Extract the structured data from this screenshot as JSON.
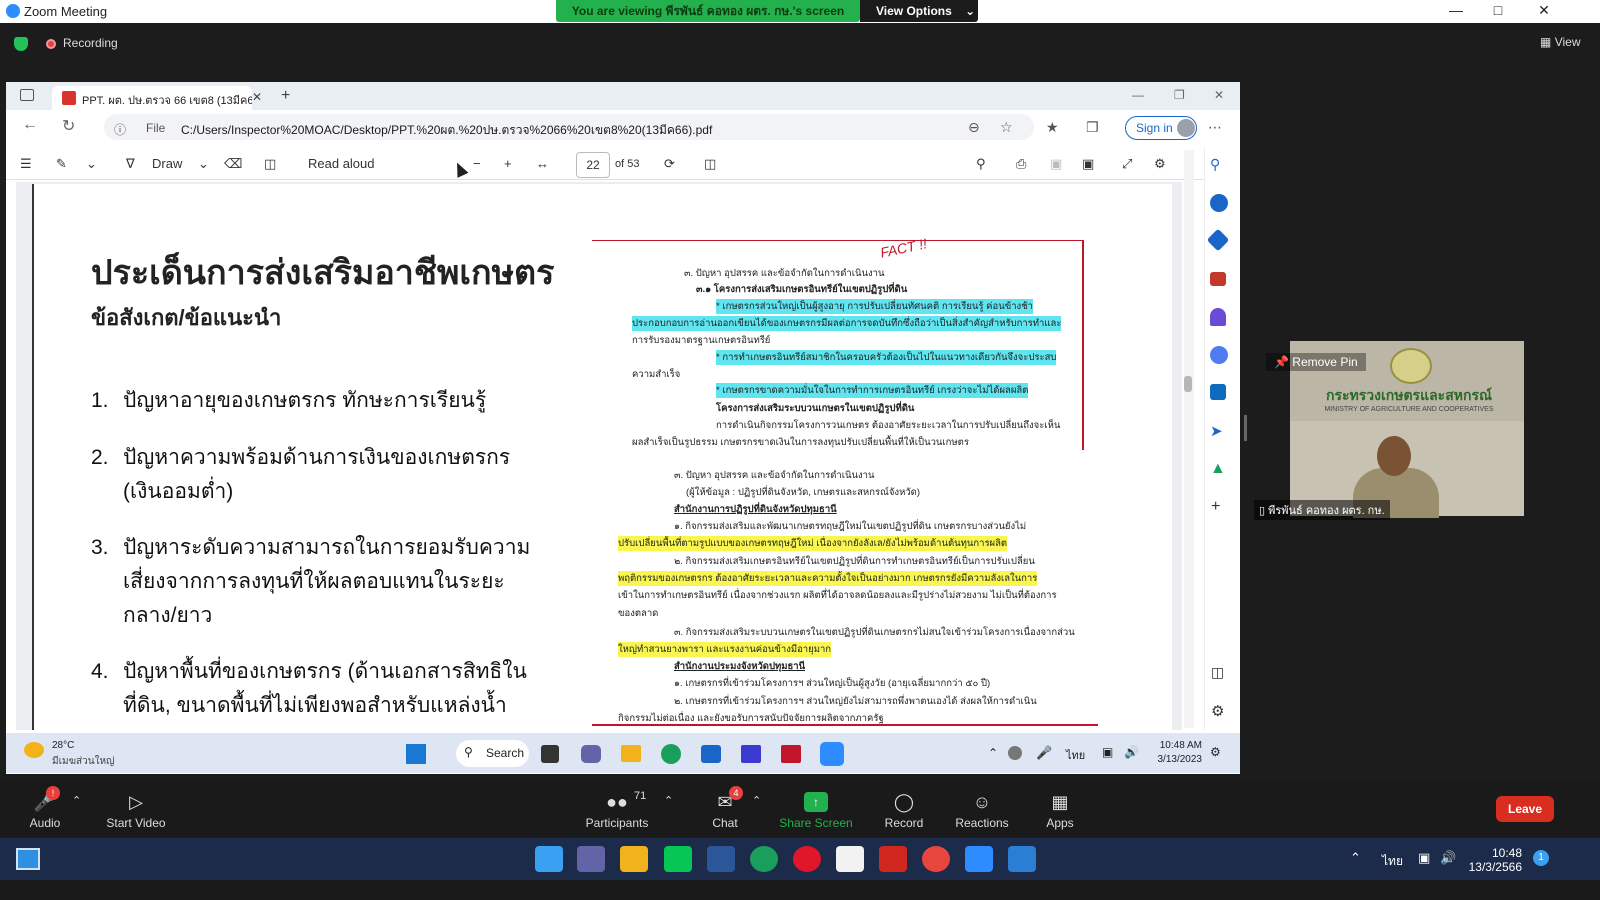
{
  "zoom": {
    "window_title": "Zoom Meeting",
    "banner_text": "You are viewing พีรพันธ์ คอทอง ผตร. กษ.'s screen",
    "view_options_label": "View Options",
    "recording_label": "Recording",
    "view_label": "View",
    "controls": {
      "audio": "Audio",
      "start_video": "Start Video",
      "participants": "Participants",
      "participants_count": "71",
      "chat": "Chat",
      "chat_badge": "4",
      "share_screen": "Share Screen",
      "record": "Record",
      "reactions": "Reactions",
      "apps": "Apps",
      "leave": "Leave"
    },
    "video": {
      "remove_pin": "Remove Pin",
      "name": "พีรพันธ์ คอทอง ผตร. กษ.",
      "ministry_th": "กระทรวงเกษตรและสหกรณ์",
      "ministry_en": "MINISTRY OF AGRICULTURE AND COOPERATIVES"
    }
  },
  "browser": {
    "tab_title": "PPT. ผต. ปษ.ตรวจ 66 เขต8 (13มีค6",
    "url_prefix": "File",
    "url": "C:/Users/Inspector%20MOAC/Desktop/PPT.%20ผต.%20ปษ.ตรวจ%2066%20เขต8%20(13มีค66).pdf",
    "sign_in": "Sign in",
    "pdf_toolbar": {
      "draw": "Draw",
      "read_aloud": "Read aloud",
      "page": "22",
      "page_total": "of 53"
    }
  },
  "slide": {
    "title": "ประเด็นการส่งเสริมอาชีพเกษตร",
    "subtitle": "ข้อสังเกต/ข้อแนะนำ",
    "items": [
      {
        "num": "1.",
        "text": "ปัญหาอายุของเกษตรกร ทักษะการเรียนรู้"
      },
      {
        "num": "2.",
        "text": "ปัญหาความพร้อมด้านการเงินของเกษตรกร (เงินออมต่ำ)"
      },
      {
        "num": "3.",
        "text": "ปัญหาระดับความสามารถในการยอมรับความเสี่ยงจากการลงทุนที่ให้ผลตอบแทนในระยะกลาง/ยาว"
      },
      {
        "num": "4.",
        "text": "ปัญหาพื้นที่ของเกษตรกร (ด้านเอกสารสิทธิในที่ดิน, ขนาดพื้นที่ไม่เพียงพอสำหรับแหล่งน้ำ"
      }
    ],
    "handwriting": "FACT !!",
    "scan_lines": [
      "๓. ปัญหา อุปสรรค และข้อจำกัดในการดำเนินงาน",
      "๓.๑ โครงการส่งเสริมเกษตรอินทรีย์ในเขตปฏิรูปที่ดิน",
      "* เกษตรกรส่วนใหญ่เป็นผู้สูงอายุ การปรับเปลี่ยนทัศนคติ การเรียนรู้ ค่อนข้างช้า",
      "ประกอบกอบการอ่านออกเขียนได้ของเกษตรกรมีผลต่อการจดบันทึกซึ่งถือว่าเป็นสิ่งสำคัญสำหรับการทำและ",
      "การรับรองมาตรฐานเกษตรอินทรีย์",
      "* การทำเกษตรอินทรีย์สมาชิกในครอบครัวต้องเป็นไปในแนวทางเดียวกันจึงจะประสบ",
      "ความสำเร็จ",
      "* เกษตรกรขาดความมั่นใจในการทำการเกษตรอินทรีย์ เกรงว่าจะไม่ได้ผลผลิต",
      "โครงการส่งเสริมระบบวนเกษตรในเขตปฏิรูปที่ดิน",
      "การดำเนินกิจกรรมโครงการวนเกษตร ต้องอาศัยระยะเวลาในการปรับเปลี่ยนถึงจะเห็น",
      "ผลสำเร็จเป็นรูปธรรม เกษตรกรขาดเงินในการลงทุนปรับเปลี่ยนพื้นที่ให้เป็นวนเกษตร",
      "๓. ปัญหา อุปสรรค และข้อจำกัดในการดำเนินงาน",
      "(ผู้ให้ข้อมูล : ปฏิรูปที่ดินจังหวัด, เกษตรและสหกรณ์จังหวัด)",
      "สำนักงานการปฏิรูปที่ดินจังหวัดปทุมธานี",
      "๑. กิจกรรมส่งเสริมและพัฒนาเกษตรทฤษฎีใหม่ในเขตปฏิรูปที่ดิน เกษตรกรบางส่วนยังไม่",
      "ปรับเปลี่ยนพื้นที่ตามรูปแบบของเกษตรทฤษฎีใหม่ เนื่องจากยังลังเล/ยังไม่พร้อมด้านต้นทุนการผลิต",
      "๒. กิจกรรมส่งเสริมเกษตรอินทรีย์ในเขตปฏิรูปที่ดินการทำเกษตรอินทรีย์เป็นการปรับเปลี่ยน",
      "พฤติกรรมของเกษตรกร ต้องอาศัยระยะเวลาและความตั้งใจเป็นอย่างมาก เกษตรกรยังมีความลังเลในการ",
      "เข้าในการทำเกษตรอินทรีย์ เนื่องจากช่วงแรก ผลิตที่ได้อาจลดน้อยลงและมีรูปร่างไม่สวยงาม ไม่เป็นที่ต้องการ",
      "ของตลาด",
      "๓. กิจกรรมส่งเสริมระบบวนเกษตรในเขตปฏิรูปที่ดินเกษตรกรไม่สนใจเข้าร่วมโครงการเนื่องจากส่วน",
      "ใหญ่ทำสวนยางพารา และแรงงานค่อนข้างมีอายุมาก",
      "สำนักงานประมงจังหวัดปทุมธานี",
      "๑. เกษตรกรที่เข้าร่วมโครงการฯ ส่วนใหญ่เป็นผู้สูงวัย (อายุเฉลี่ยมากกว่า ๕๐ ปี)",
      "๒. เกษตรกรที่เข้าร่วมโครงการฯ ส่วนใหญ่ยังไม่สามารถพึ่งพาตนเองได้ ส่งผลให้การดำเนิน",
      "กิจกรรมไม่ต่อเนื่อง และยังขอรับการสนับปัจจัยการผลิตจากภาครัฐ"
    ]
  },
  "inner_taskbar": {
    "weather_temp": "28°C",
    "weather_desc": "มีเมฆส่วนใหญ่",
    "search": "Search",
    "lang": "ไทย",
    "time": "10:48 AM",
    "date": "3/13/2023"
  },
  "win_taskbar": {
    "lang": "ไทย",
    "time": "10:48",
    "date": "13/3/2566"
  }
}
